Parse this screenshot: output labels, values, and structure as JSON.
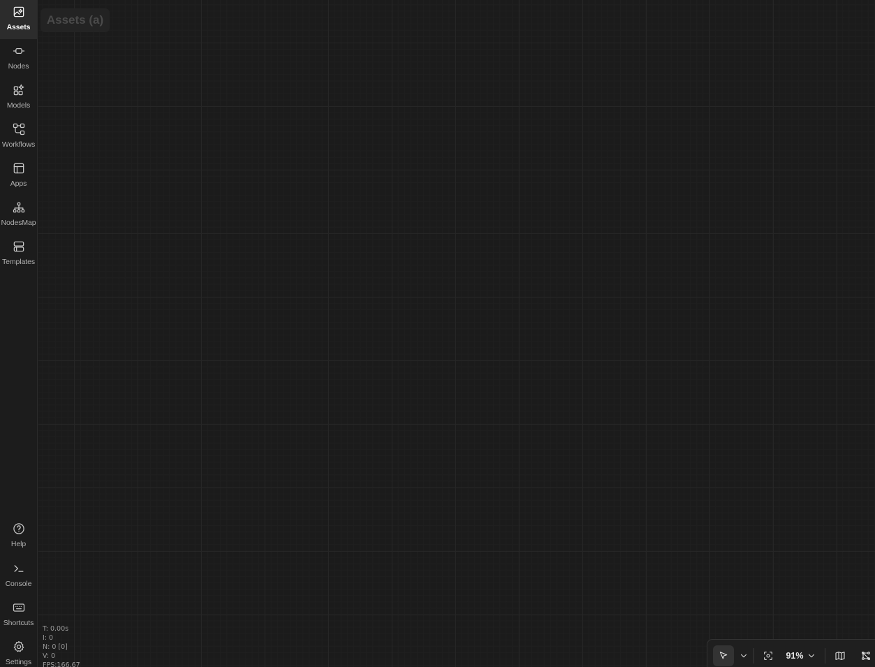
{
  "sidebar": {
    "top_items": [
      {
        "label": "Assets",
        "icon": "image-sparkle-icon",
        "active": true
      },
      {
        "label": "Nodes",
        "icon": "node-connector-icon",
        "active": false
      },
      {
        "label": "Models",
        "icon": "models-sparkle-icon",
        "active": false
      },
      {
        "label": "Workflows",
        "icon": "workflow-icon",
        "active": false
      },
      {
        "label": "Apps",
        "icon": "app-layout-icon",
        "active": false
      },
      {
        "label": "NodesMap",
        "icon": "sitemap-icon",
        "active": false
      },
      {
        "label": "Templates",
        "icon": "templates-icon",
        "active": false
      }
    ],
    "bottom_items": [
      {
        "label": "Help",
        "icon": "help-circle-icon"
      },
      {
        "label": "Console",
        "icon": "terminal-icon"
      },
      {
        "label": "Shortcuts",
        "icon": "keyboard-icon"
      },
      {
        "label": "Settings",
        "icon": "gear-icon"
      }
    ]
  },
  "canvas": {
    "panel_label": "Assets (a)",
    "stats": {
      "t": "T: 0.00s",
      "i": "I: 0",
      "n": "N: 0 [0]",
      "v": "V: 0",
      "fps": "FPS:166.67"
    }
  },
  "toolbar": {
    "zoom": "91%",
    "icons": [
      "cursor-select-icon",
      "chevron-down-icon",
      "focus-fit-icon",
      "chevron-down-icon",
      "minimap-icon",
      "hide-links-icon"
    ]
  },
  "colors": {
    "background": "#1b1b1b",
    "sidebar": "#1c1c1c",
    "active_item": "#2c2c2c"
  }
}
